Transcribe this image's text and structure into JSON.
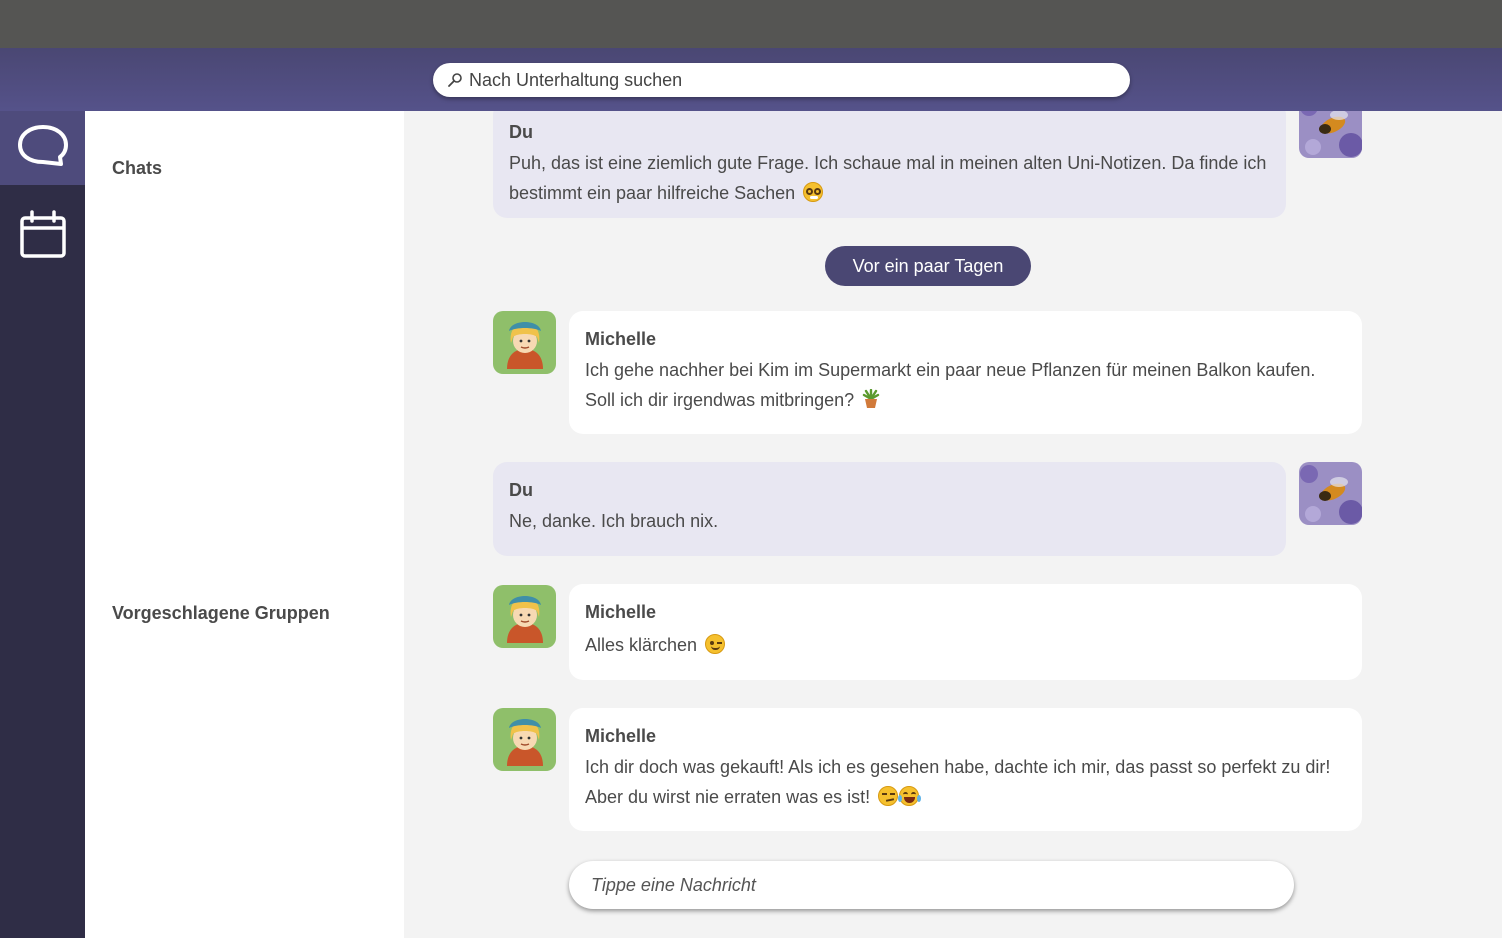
{
  "search": {
    "placeholder": "Nach Unterhaltung suchen"
  },
  "nav": {
    "items": [
      {
        "name": "chats",
        "icon": "chat-bubble-icon",
        "active": true
      },
      {
        "name": "calendar",
        "icon": "calendar-icon",
        "active": false
      }
    ]
  },
  "sidebar": {
    "chats_title": "Chats",
    "groups_title": "Vorgeschlagene Gruppen"
  },
  "date_separator": "Vor ein paar Tagen",
  "messages": [
    {
      "sender": "Du",
      "text": "Puh, das ist eine ziemlich gute Frage. Ich schaue mal in meinen alten Uni-Notizen. Da finde ich bestimmt ein paar hilfreiche Sachen",
      "emoji": "nerd-face-icon",
      "mine": true
    },
    {
      "sender": "Michelle",
      "text": "Ich gehe nachher bei Kim im Supermarkt ein paar neue Pflanzen für meinen Balkon kaufen. Soll ich dir irgendwas mitbringen?",
      "emoji": "potted-plant-icon",
      "mine": false
    },
    {
      "sender": "Du",
      "text": "Ne, danke. Ich brauch nix.",
      "mine": true
    },
    {
      "sender": "Michelle",
      "text": "Alles klärchen",
      "emoji": "winking-face-icon",
      "mine": false
    },
    {
      "sender": "Michelle",
      "text": "Ich dir doch was gekauft! Als ich es gesehen habe, dachte ich mir, das passt so perfekt zu dir!  Aber du wirst nie erraten was es ist!",
      "emoji": "smirk-laugh-icons",
      "mine": false
    }
  ],
  "composer": {
    "placeholder": "Tippe eine Nachricht"
  },
  "colors": {
    "header": "#4a4773",
    "rail": "#2f2d46",
    "rail_active": "#4e4b7c",
    "own_bubble": "#e8e7f2",
    "other_bubble": "#ffffff",
    "pill": "#4a4773"
  }
}
